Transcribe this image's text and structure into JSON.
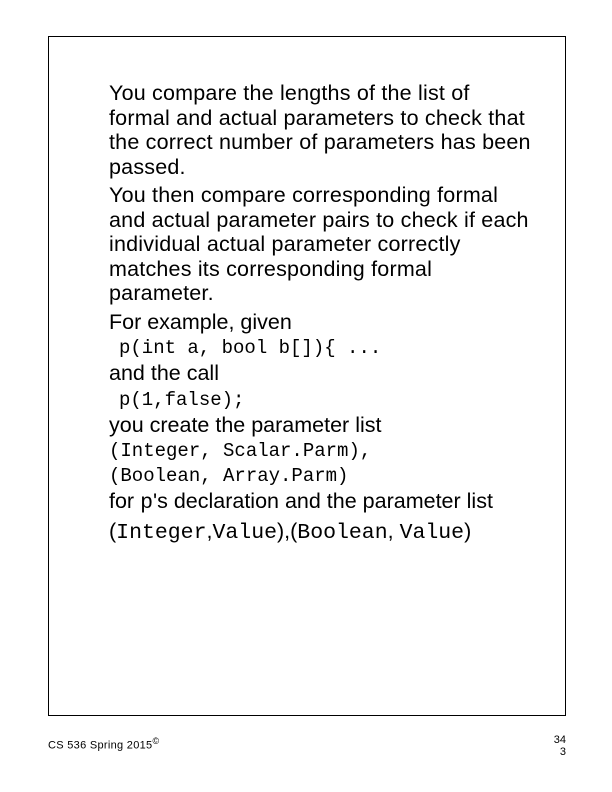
{
  "slide": {
    "p1": "You compare the lengths of the list of formal and actual parameters to check that the correct number of parameters has been passed.",
    "p2": "You then compare corresponding formal and actual parameter pairs to check if each individual actual parameter correctly matches its corresponding formal parameter.",
    "for_example": "For example, given",
    "code1": "p(int a, bool b[]){ ...",
    "and_the_call": "and the call",
    "code2": "p(1,false);",
    "you_create": "you create the parameter list",
    "paramlist1a": "(Integer, Scalar.Parm),",
    "paramlist1b": "(Boolean, Array.Parm)",
    "for_ps_decl_prefix": "for ",
    "for_ps_decl_code": "p",
    "for_ps_decl_suffix": "'s declaration and the parameter list",
    "paramlist2_open1": "(",
    "paramlist2_w1": "Integer",
    "paramlist2_sep1": ",",
    "paramlist2_w2": "Value",
    "paramlist2_close1": "),(",
    "paramlist2_w3": "Boolean",
    "paramlist2_sep2": ", ",
    "paramlist2_w4": "Value",
    "paramlist2_close2": ")"
  },
  "footer": {
    "left": "CS 536  Spring 2015",
    "copymark": "©",
    "pagenum_top": "34",
    "pagenum_bottom": "3"
  }
}
